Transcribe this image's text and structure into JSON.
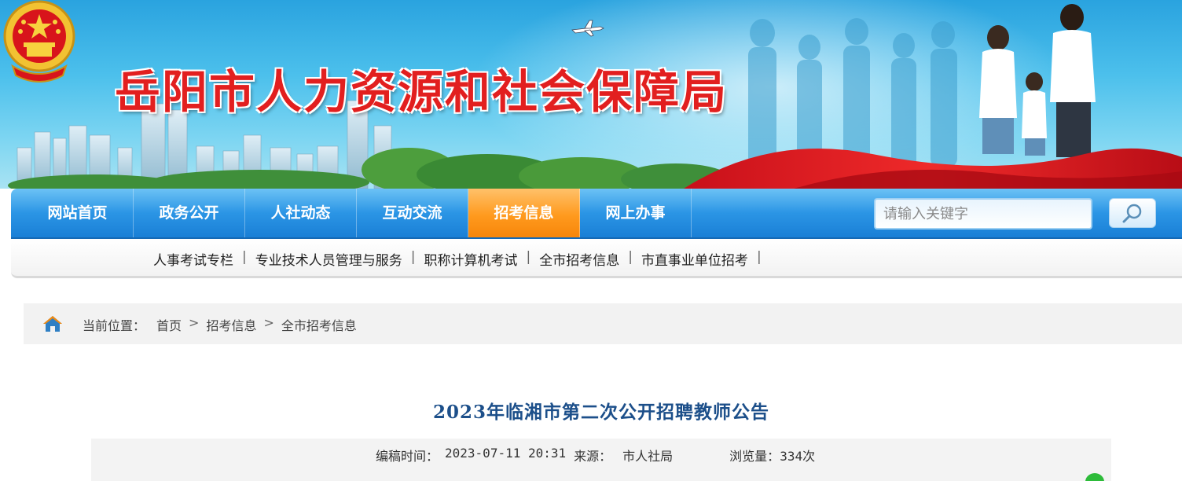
{
  "header": {
    "site_title": "岳阳市人力资源和社会保障局"
  },
  "nav": {
    "items": [
      {
        "label": "网站首页",
        "active": false
      },
      {
        "label": "政务公开",
        "active": false
      },
      {
        "label": "人社动态",
        "active": false
      },
      {
        "label": "互动交流",
        "active": false
      },
      {
        "label": "招考信息",
        "active": true
      },
      {
        "label": "网上办事",
        "active": false
      }
    ],
    "search_placeholder": "请输入关键字",
    "active_color": "#f7860a",
    "bar_color": "#2b95e5"
  },
  "subnav": {
    "items": [
      {
        "label": "人事考试专栏"
      },
      {
        "label": "专业技术人员管理与服务"
      },
      {
        "label": "职称计算机考试"
      },
      {
        "label": "全市招考信息"
      },
      {
        "label": "市直事业单位招考"
      }
    ],
    "separator": "|"
  },
  "breadcrumb": {
    "prefix": "当前位置：",
    "items": [
      "首页",
      "招考信息",
      "全市招考信息"
    ],
    "separator": ">"
  },
  "article": {
    "title": "2023年临湘市第二次公开招聘教师公告",
    "edit_time_label": "编稿时间：",
    "edit_time": "2023-07-11 20:31",
    "source_label": "来源：",
    "source": "市人社局",
    "views_label": "浏览量：",
    "views": "334次"
  },
  "icons": {
    "home": "home-icon",
    "search": "search-icon",
    "share": "wechat-icon",
    "emblem": "national-emblem"
  }
}
